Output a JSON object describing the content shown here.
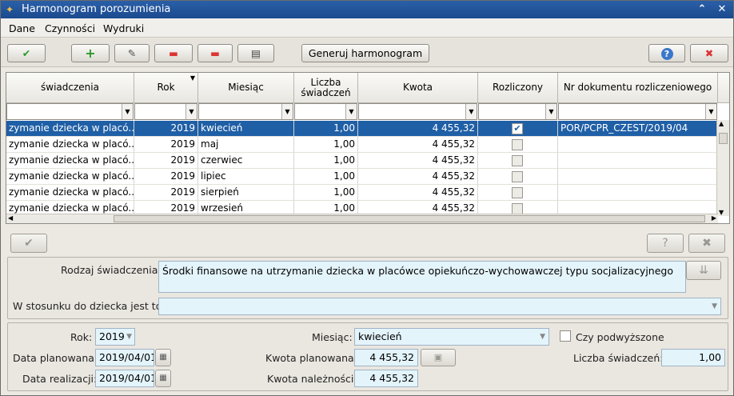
{
  "window": {
    "title": "Harmonogram porozumienia"
  },
  "menu": [
    "Dane",
    "Czynności",
    "Wydruki"
  ],
  "toolbar": {
    "generate_label": "Generuj harmonogram"
  },
  "grid": {
    "columns": [
      "świadczenia",
      "Rok",
      "Miesiąc",
      "Liczba świadczeń",
      "Kwota",
      "Rozliczony",
      "Nr dokumentu rozliczeniowego"
    ],
    "rows": [
      {
        "swiadczenie": "zymanie dziecka w placó...",
        "rok": "2019",
        "miesiac": "kwiecień",
        "liczba": "1,00",
        "kwota": "4 455,32",
        "rozliczony": true,
        "nr_dok": "POR/PCPR_CZEST/2019/04"
      },
      {
        "swiadczenie": "zymanie dziecka w placó...",
        "rok": "2019",
        "miesiac": "maj",
        "liczba": "1,00",
        "kwota": "4 455,32",
        "rozliczony": false,
        "nr_dok": ""
      },
      {
        "swiadczenie": "zymanie dziecka w placó...",
        "rok": "2019",
        "miesiac": "czerwiec",
        "liczba": "1,00",
        "kwota": "4 455,32",
        "rozliczony": false,
        "nr_dok": ""
      },
      {
        "swiadczenie": "zymanie dziecka w placó...",
        "rok": "2019",
        "miesiac": "lipiec",
        "liczba": "1,00",
        "kwota": "4 455,32",
        "rozliczony": false,
        "nr_dok": ""
      },
      {
        "swiadczenie": "zymanie dziecka w placó...",
        "rok": "2019",
        "miesiac": "sierpień",
        "liczba": "1,00",
        "kwota": "4 455,32",
        "rozliczony": false,
        "nr_dok": ""
      },
      {
        "swiadczenie": "zymanie dziecka w placó...",
        "rok": "2019",
        "miesiac": "wrzesień",
        "liczba": "1,00",
        "kwota": "4 455,32",
        "rozliczony": false,
        "nr_dok": ""
      }
    ]
  },
  "detail": {
    "rodzaj_label": "Rodzaj świadczenia:",
    "rodzaj_value": "Środki finansowe na utrzymanie dziecka w placówce opiekuńczo-wychowawczej typu socjalizacyjnego",
    "stosunek_label": "W stosunku do dziecka jest to:",
    "stosunek_value": "",
    "rok_label": "Rok:",
    "rok_value": "2019",
    "miesiac_label": "Miesiąc:",
    "miesiac_value": "kwiecień",
    "podwyzszone_label": "Czy podwyższone",
    "data_plan_label": "Data planowana:",
    "data_plan_value": "2019/04/01",
    "kwota_plan_label": "Kwota planowana:",
    "kwota_plan_value": "4 455,32",
    "liczba_label": "Liczba świadczeń:",
    "liczba_value": "1,00",
    "data_real_label": "Data realizacji:",
    "data_real_value": "2019/04/01",
    "kwota_nal_label": "Kwota należności:",
    "kwota_nal_value": "4 455,32"
  }
}
